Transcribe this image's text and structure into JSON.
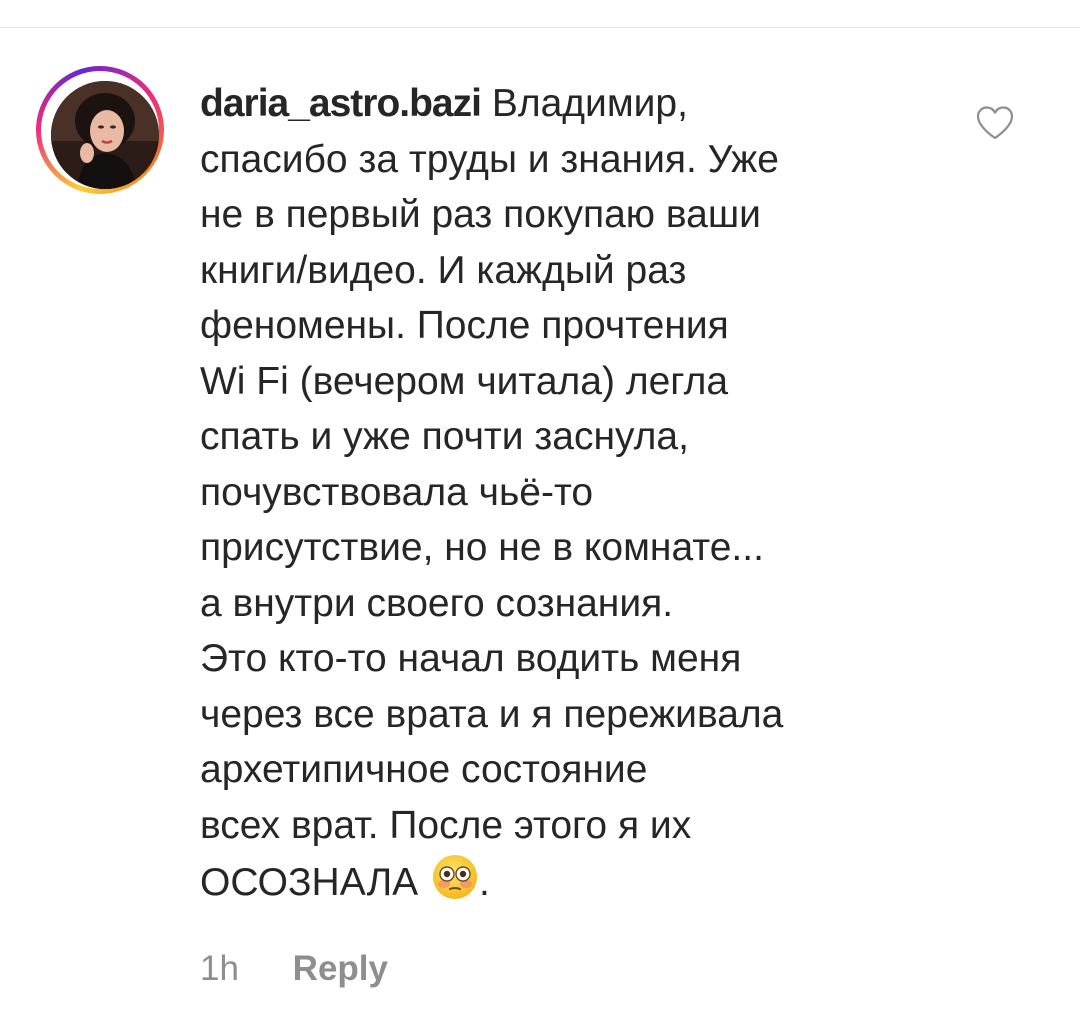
{
  "comment": {
    "username": "daria_astro.bazi",
    "text_lines": [
      "Владимир,",
      "спасибо за труды и знания. Уже",
      "не в первый раз покупаю ваши",
      "книги/видео. И каждый раз",
      "феномены. После прочтения",
      "Wi Fi (вечером читала) легла",
      "спать и уже почти заснула,",
      "почувствовала чьё-то",
      "присутствие, но не в комнате...",
      "а внутри своего сознания.",
      "Это кто-то начал водить меня",
      "через все врата и я переживала",
      "архетипичное состояние",
      "всех врат. После этого я их",
      "ОСОЗНАЛА"
    ],
    "trailing_punct": ".",
    "emoji": "flushed-face-emoji",
    "time": "1h",
    "reply_label": "Reply"
  },
  "icons": {
    "like": "heart-outline-icon",
    "avatar": "user-avatar"
  },
  "colors": {
    "text": "#262626",
    "muted": "#8e8e8e",
    "heart_stroke": "#8e8e8e",
    "story_ring": [
      "#f9ce34",
      "#ee2a7b",
      "#6228d7"
    ]
  }
}
